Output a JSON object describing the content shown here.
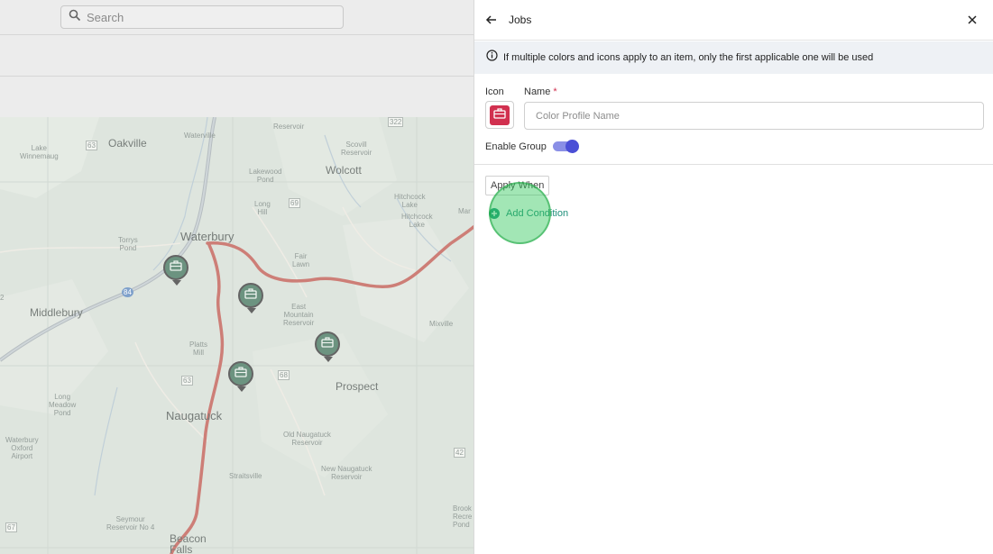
{
  "background": {
    "search_placeholder": "Search"
  },
  "map": {
    "labels": {
      "oakville": "Oakville",
      "waterville": "Waterville",
      "lake_winnemaug": "Lake\nWinnemaug",
      "lakewood_pond": "Lakewood\nPond",
      "long_hill": "Long\nHill",
      "wolcott": "Wolcott",
      "scovill_reservoir": "Scovill\nReservoir",
      "reservoir": "Reservoir",
      "hitchcock_lake": "Hitchcock\nLake",
      "hitchcock_lake2": "Hitchcock\nLake",
      "waterbury": "Waterbury",
      "torrys_pond": "Torrys\nPond",
      "fair_lawn": "Fair\nLawn",
      "middlebury": "Middlebury",
      "east_mountain_reservoir": "East\nMountain\nReservoir",
      "mixville": "Mixville",
      "platts_mill": "Platts\nMill",
      "prospect": "Prospect",
      "long_meadow_pond": "Long\nMeadow\nPond",
      "naugatuck": "Naugatuck",
      "old_naugatuck_reservoir": "Old Naugatuck\nReservoir",
      "waterbury_oxford_airport": "Waterbury\nOxford\nAirport",
      "new_naugatuck_reservoir": "New Naugatuck\nReservoir",
      "straitsville": "Straitsville",
      "seymour_reservoir": "Seymour\nReservoir No 4",
      "beacon_falls": "Beacon\nFalls",
      "brook_recre": "Brook\nRecre\nPond",
      "marion": "Mar",
      "route_2": "2",
      "shield_63a": "63",
      "shield_69": "69",
      "shield_322": "322",
      "shield_63b": "63",
      "shield_68": "68",
      "shield_42": "42",
      "shield_67": "67",
      "shield_84": "84"
    },
    "pins": [
      {
        "icon": "briefcase-icon"
      },
      {
        "icon": "briefcase-icon"
      },
      {
        "icon": "briefcase-icon"
      },
      {
        "icon": "briefcase-icon"
      }
    ]
  },
  "panel": {
    "title": "Jobs",
    "info_text": "If multiple colors and icons apply to an item, only the first applicable one will be used",
    "icon_label": "Icon",
    "icon_color": "#d1304f",
    "name_label": "Name",
    "name_required": "*",
    "name_placeholder": "Color Profile Name",
    "name_value": "",
    "enable_group_label": "Enable Group",
    "enable_group_on": true,
    "apply_when_label": "Apply When",
    "add_condition_label": "Add Condition"
  },
  "colors": {
    "accent": "#4b4fd6",
    "toggle_track": "#8a8fe6",
    "add_condition": "#1f8f7a",
    "highlight": "#30c85a",
    "pin": "#1e5a3c",
    "road": "#b23a2e"
  }
}
